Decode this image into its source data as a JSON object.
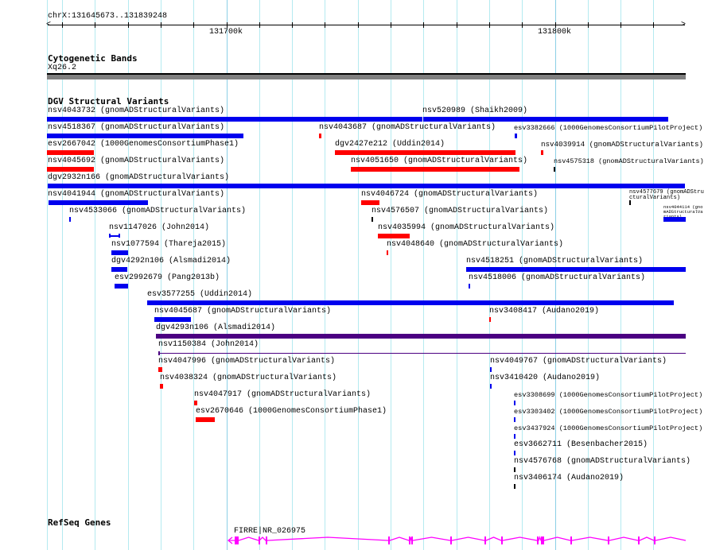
{
  "ruler": {
    "location": "chrX:131645673..131839248",
    "tick_labels": [
      "131700k",
      "131800k"
    ]
  },
  "tracks": {
    "cytobands": {
      "title": "Cytogenetic Bands",
      "band": "Xq26.2"
    },
    "dgv": {
      "title": "DGV Structural Variants"
    },
    "refseq": {
      "title": "RefSeq Genes",
      "gene_label": "FIRRE|NR_026975"
    }
  },
  "colors": {
    "loss": "#ff0000",
    "gain": "#0000ee",
    "other": "#000000",
    "complex": "#4b0082",
    "gene": "#ff00ff"
  },
  "features": [
    {
      "label": "nsv4043732 (gnomADStructuralVariants)",
      "color": "gain"
    },
    {
      "label": "nsv520989 (Shaikh2009)",
      "color": "gain"
    },
    {
      "label": "nsv4518367 (gnomADStructuralVariants)",
      "color": "gain"
    },
    {
      "label": "nsv4043687 (gnomADStructuralVariants)",
      "color": "loss"
    },
    {
      "label": "esv3382666 (1000GenomesConsortiumPilotProject)",
      "color": "gain"
    },
    {
      "label": "esv2667042 (1000GenomesConsortiumPhase1)",
      "color": "loss"
    },
    {
      "label": "dgv2427e212 (Uddin2014)",
      "color": "loss"
    },
    {
      "label": "nsv4039914 (gnomADStructuralVariants)",
      "color": "loss"
    },
    {
      "label": "nsv4045692 (gnomADStructuralVariants)",
      "color": "loss"
    },
    {
      "label": "nsv4051650 (gnomADStructuralVariants)",
      "color": "loss"
    },
    {
      "label": "nsv4575318 (gnomADStructuralVariants)",
      "color": "other"
    },
    {
      "label": "dgv2932n166 (gnomADStructuralVariants)",
      "color": "gain"
    },
    {
      "label": "nsv4041944 (gnomADStructuralVariants)",
      "color": "gain"
    },
    {
      "label": "nsv4046724 (gnomADStructuralVariants)",
      "color": "loss"
    },
    {
      "label": "nsv4577679 (gnomADStructuralVariants)",
      "color": "other"
    },
    {
      "label": "nsv4533066 (gnomADStructuralVariants)",
      "color": "gain"
    },
    {
      "label": "nsv4576507 (gnomADStructuralVariants)",
      "color": "other"
    },
    {
      "label": "nsv4044114 (gnomADStructuralVariants)",
      "color": "gain"
    },
    {
      "label": "nsv1147026 (John2014)",
      "color": "gain"
    },
    {
      "label": "nsv4035994 (gnomADStructuralVariants)",
      "color": "loss"
    },
    {
      "label": "nsv1077594 (Thareja2015)",
      "color": "gain"
    },
    {
      "label": "nsv4048640 (gnomADStructuralVariants)",
      "color": "loss"
    },
    {
      "label": "dgv4292n106 (Alsmadi2014)",
      "color": "gain"
    },
    {
      "label": "nsv4518251 (gnomADStructuralVariants)",
      "color": "gain"
    },
    {
      "label": "esv2992679 (Pang2013b)",
      "color": "gain"
    },
    {
      "label": "nsv4518006 (gnomADStructuralVariants)",
      "color": "gain"
    },
    {
      "label": "esv3577255 (Uddin2014)",
      "color": "gain"
    },
    {
      "label": "nsv4045687 (gnomADStructuralVariants)",
      "color": "gain"
    },
    {
      "label": "nsv3408417 (Audano2019)",
      "color": "loss"
    },
    {
      "label": "dgv4293n106 (Alsmadi2014)",
      "color": "complex"
    },
    {
      "label": "nsv1150384 (John2014)",
      "color": "complex"
    },
    {
      "label": "nsv4047996 (gnomADStructuralVariants)",
      "color": "loss"
    },
    {
      "label": "nsv4049767 (gnomADStructuralVariants)",
      "color": "gain"
    },
    {
      "label": "nsv4038324 (gnomADStructuralVariants)",
      "color": "loss"
    },
    {
      "label": "nsv3410420 (Audano2019)",
      "color": "gain"
    },
    {
      "label": "nsv4047917 (gnomADStructuralVariants)",
      "color": "loss"
    },
    {
      "label": "esv3308699 (1000GenomesConsortiumPilotProject)",
      "color": "gain"
    },
    {
      "label": "esv2670646 (1000GenomesConsortiumPhase1)",
      "color": "loss"
    },
    {
      "label": "esv3303402 (1000GenomesConsortiumPilotProject)",
      "color": "gain"
    },
    {
      "label": "esv3437924 (1000GenomesConsortiumPilotProject)",
      "color": "gain"
    },
    {
      "label": "esv3662711 (Besenbacher2015)",
      "color": "gain"
    },
    {
      "label": "nsv4576768 (gnomADStructuralVariants)",
      "color": "other"
    },
    {
      "label": "nsv3406174 (Audano2019)",
      "color": "other"
    }
  ]
}
